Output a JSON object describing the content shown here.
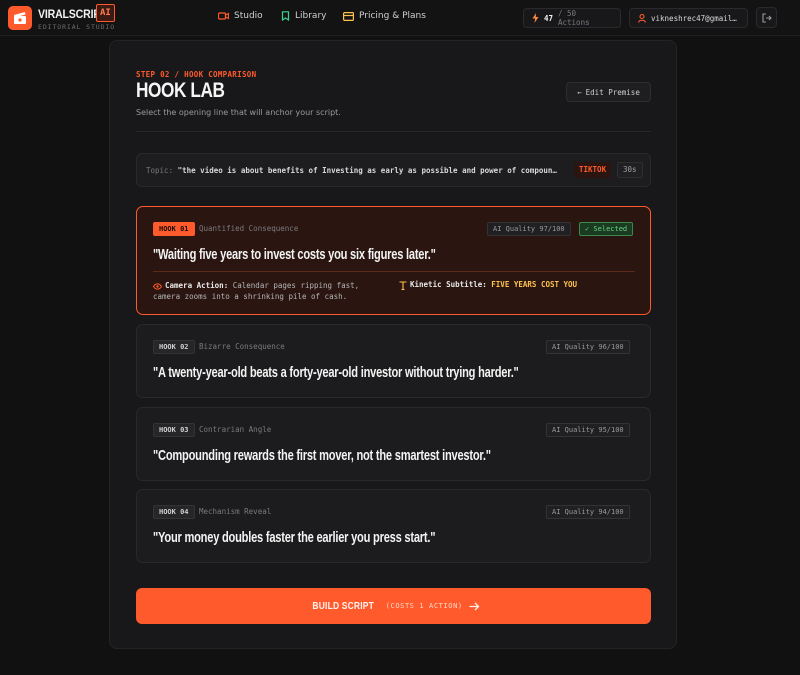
{
  "brand": {
    "name": "VIRALSCRIPT",
    "badge": "AI",
    "subtitle": "EDITORIAL STUDIO"
  },
  "nav": {
    "links": [
      {
        "label": "Studio",
        "icon": "clapper-icon"
      },
      {
        "label": "Library",
        "icon": "bookmark-icon"
      },
      {
        "label": "Pricing & Plans",
        "icon": "card-icon"
      }
    ],
    "actions_used": "47",
    "actions_total": "/ 50 Actions",
    "user_email": "vikneshrec47@gmail…"
  },
  "header": {
    "step": "STEP 02 / HOOK COMPARISON",
    "title": "HOOK LAB",
    "subtitle": "Select the opening line that will anchor your script.",
    "edit_button": "Edit Premise"
  },
  "topic": {
    "label": "Topic:",
    "text": "\"the video is about benefits of Investing as early as possible and power of compoun…",
    "platform": "TIKTOK",
    "duration": "30s"
  },
  "hooks": [
    {
      "num": "HOOK 01",
      "type": "Quantified Consequence",
      "quality": "AI Quality 97/100",
      "selected_label": "✓ Selected",
      "line": "\"Waiting five years to invest costs you six figures later.\"",
      "camera_label": "Camera Action:",
      "camera_text": "Calendar pages ripping fast, camera zooms into a shrinking pile of cash.",
      "kinetic_label": "Kinetic Subtitle:",
      "kinetic_text": "FIVE YEARS COST YOU"
    },
    {
      "num": "HOOK 02",
      "type": "Bizarre Consequence",
      "quality": "AI Quality 96/100",
      "line": "\"A twenty-year-old beats a forty-year-old investor without trying harder.\""
    },
    {
      "num": "HOOK 03",
      "type": "Contrarian Angle",
      "quality": "AI Quality 95/100",
      "line": "\"Compounding rewards the first mover, not the smartest investor.\""
    },
    {
      "num": "HOOK 04",
      "type": "Mechanism Reveal",
      "quality": "AI Quality 94/100",
      "line": "\"Your money doubles faster the earlier you press start.\""
    }
  ],
  "build": {
    "label": "BUILD SCRIPT",
    "cost": "(COSTS 1 ACTION)"
  },
  "colors": {
    "accent": "#ff5a2c",
    "background": "#111112",
    "panel": "#18181a",
    "kinetic": "#ffc34d",
    "selected_green": "#6ad47d"
  }
}
